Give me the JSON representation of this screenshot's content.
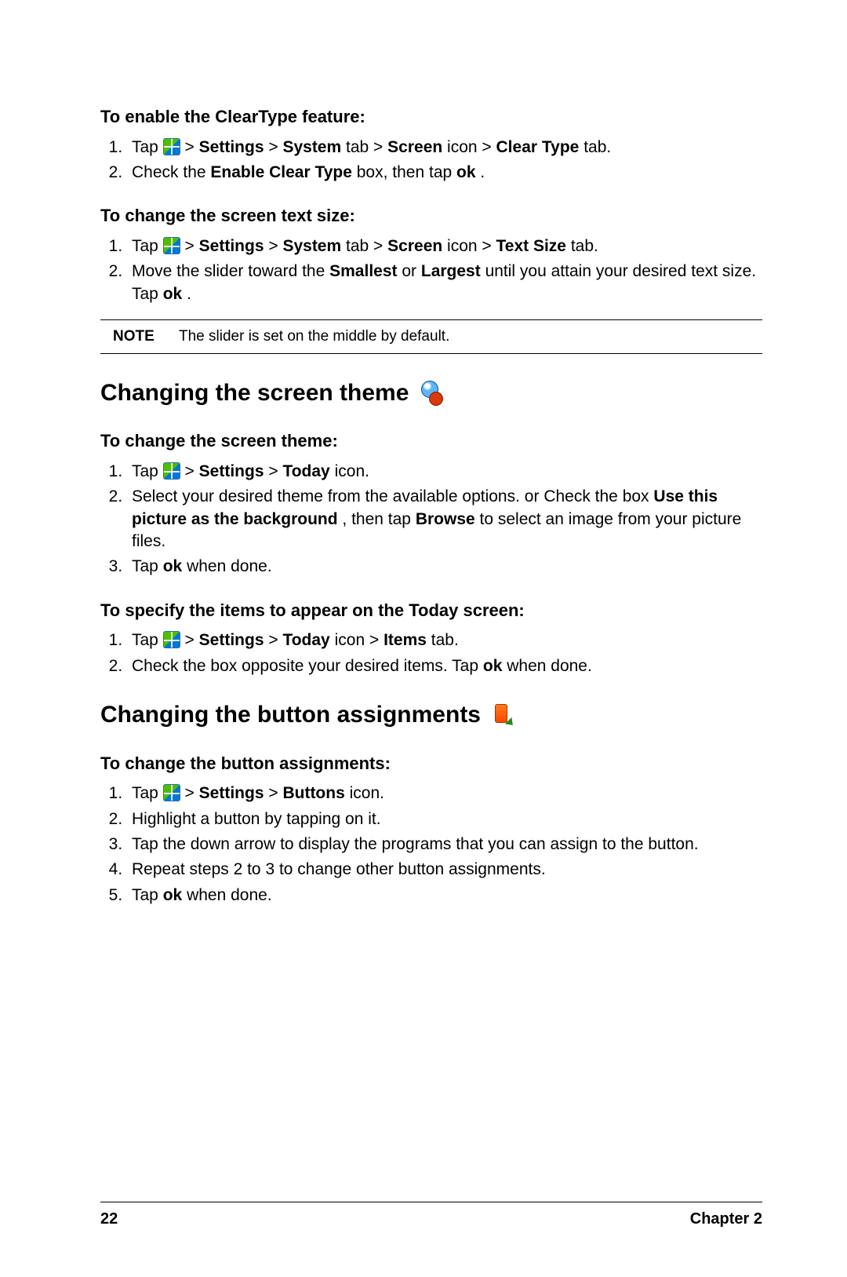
{
  "sections": {
    "cleartype": {
      "heading": "To enable the ClearType feature:",
      "step1_a": "Tap ",
      "step1_b": " > ",
      "step1_settings": "Settings",
      "step1_c": " > ",
      "step1_system": "System",
      "step1_d": " tab > ",
      "step1_screen": "Screen",
      "step1_e": " icon > ",
      "step1_ct": "Clear Type",
      "step1_f": " tab.",
      "step2_a": "Check the ",
      "step2_enable": "Enable Clear Type",
      "step2_b": " box, then tap ",
      "step2_ok": "ok",
      "step2_c": "."
    },
    "textsize": {
      "heading": "To change the screen text size:",
      "step1_a": "Tap ",
      "step1_b": " > ",
      "step1_settings": "Settings",
      "step1_c": " >  ",
      "step1_system": "System",
      "step1_d": " tab > ",
      "step1_screen": "Screen",
      "step1_e": " icon > ",
      "step1_ts": "Text Size",
      "step1_f": " tab.",
      "step2_a": "Move the slider toward the ",
      "step2_small": "Smallest",
      "step2_b": " or ",
      "step2_large": "Largest",
      "step2_c": " until you attain your desired text size. Tap ",
      "step2_ok": "ok",
      "step2_d": "."
    },
    "note": {
      "label": "NOTE",
      "text": "The slider is set on the middle by default."
    },
    "theme": {
      "title": "Changing the screen theme",
      "sub1": "To change the screen theme:",
      "s1_a": "Tap ",
      "s1_b": " > ",
      "s1_settings": "Settings",
      "s1_c": " > ",
      "s1_today": "Today",
      "s1_d": " icon.",
      "s2_a": "Select your desired theme from the available options.",
      "s2_or": "or",
      "s2_b": "Check the box ",
      "s2_use": "Use this picture as the background",
      "s2_c": ", then tap ",
      "s2_browse": "Browse",
      "s2_d": " to select an image from your picture files.",
      "s3_a": "Tap ",
      "s3_ok": "ok",
      "s3_b": " when done.",
      "sub2": "To specify the items to appear on the Today screen:",
      "i1_a": "Tap ",
      "i1_b": " > ",
      "i1_settings": "Settings",
      "i1_c": " >  ",
      "i1_today": "Today",
      "i1_d": " icon > ",
      "i1_items": "Items",
      "i1_e": " tab.",
      "i2_a": "Check the box opposite your desired items. Tap ",
      "i2_ok": "ok",
      "i2_b": " when done."
    },
    "buttons": {
      "title": "Changing the button assignments",
      "sub": "To change the button assignments:",
      "b1_a": "Tap ",
      "b1_b": " > ",
      "b1_settings": "Settings",
      "b1_c": " > ",
      "b1_buttons": "Buttons",
      "b1_d": " icon.",
      "b2": "Highlight a button by tapping on it.",
      "b3": "Tap the down arrow to display the programs that you can assign to the button.",
      "b4": "Repeat steps 2 to 3 to change other button assignments.",
      "b5_a": "Tap ",
      "b5_ok": "ok",
      "b5_b": " when done."
    }
  },
  "footer": {
    "page": "22",
    "chapter": "Chapter 2"
  }
}
